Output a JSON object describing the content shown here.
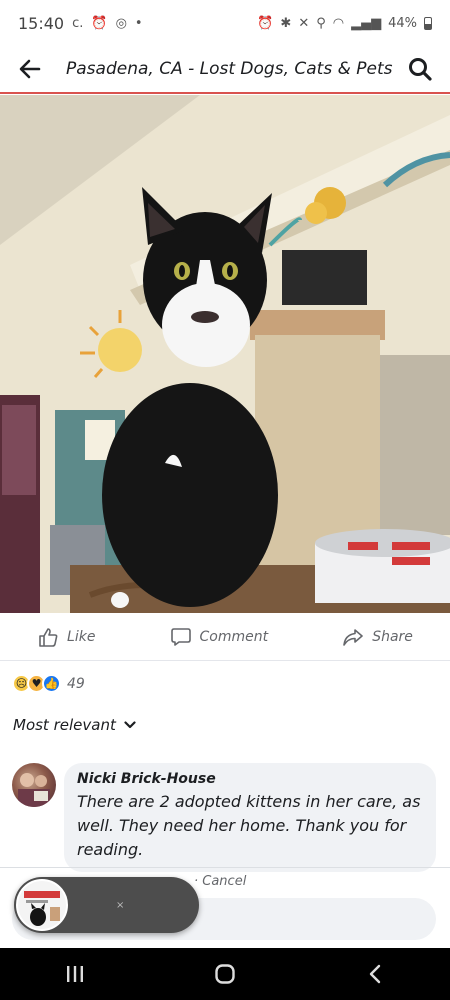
{
  "status_bar": {
    "time": "15:40",
    "battery": "44%"
  },
  "header": {
    "title": "Pasadena, CA - Lost Dogs, Cats & Pets"
  },
  "actions": {
    "like": "Like",
    "comment": "Comment",
    "share": "Share"
  },
  "reactions": {
    "count": "49"
  },
  "sort": {
    "label": "Most relevant"
  },
  "comment": {
    "author": "Nicki Brick-House",
    "text": "There are 2 adopted kittens in her care, as well. They need her home.  Thank you for reading."
  },
  "reply": {
    "status_text": "· Cancel",
    "placeholder": ""
  },
  "chathead": {
    "close": "×"
  },
  "colors": {
    "header_accent": "#d9534f",
    "like_blue": "#1877f2",
    "bubble_bg": "#f0f2f5",
    "text_secondary": "#65676b"
  },
  "icons": {
    "back": "arrow-left-icon",
    "search": "search-icon",
    "like": "thumbs-up-icon",
    "comment": "speech-bubble-icon",
    "share": "share-arrow-icon",
    "sort": "chevron-down-icon"
  }
}
